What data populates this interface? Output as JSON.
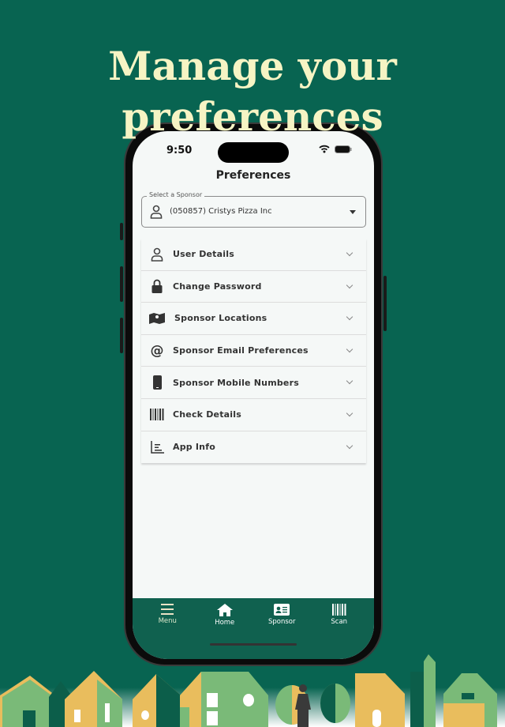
{
  "hero_title": [
    "Manage your",
    "preferences"
  ],
  "status": {
    "time": "9:50"
  },
  "page_title": "Preferences",
  "sponsor_select": {
    "label": "Select a Sponsor",
    "value": "(050857) Cristys Pizza Inc"
  },
  "sections": [
    {
      "label": "User Details",
      "icon": "person-icon"
    },
    {
      "label": "Change Password",
      "icon": "lock-icon"
    },
    {
      "label": "Sponsor Locations",
      "icon": "map-icon"
    },
    {
      "label": "Sponsor Email Preferences",
      "icon": "at-icon"
    },
    {
      "label": "Sponsor Mobile Numbers",
      "icon": "phone-icon"
    },
    {
      "label": "Check Details",
      "icon": "barcode-icon"
    },
    {
      "label": "App Info",
      "icon": "chart-icon"
    }
  ],
  "nav": [
    {
      "label": "Menu"
    },
    {
      "label": "Home"
    },
    {
      "label": "Sponsor"
    },
    {
      "label": "Scan"
    }
  ],
  "colors": {
    "background": "#086451",
    "title": "#f6f4c4",
    "nav": "#10614f"
  }
}
